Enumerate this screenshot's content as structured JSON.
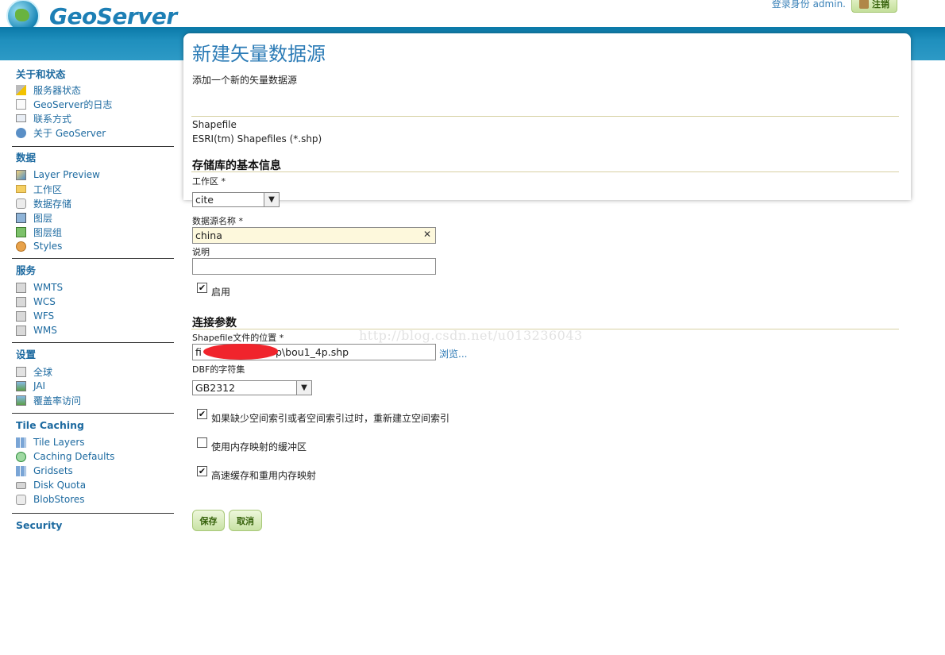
{
  "header": {
    "logo_text": "GeoServer",
    "login_text": "登录身份 admin.",
    "logout_label": "注销"
  },
  "sidebar": {
    "sections": [
      {
        "title": "关于和状态",
        "items": [
          "服务器状态",
          "GeoServer的日志",
          "联系方式",
          "关于 GeoServer"
        ]
      },
      {
        "title": "数据",
        "items": [
          "Layer Preview",
          "工作区",
          "数据存储",
          "图层",
          "图层组",
          "Styles"
        ]
      },
      {
        "title": "服务",
        "items": [
          "WMTS",
          "WCS",
          "WFS",
          "WMS"
        ]
      },
      {
        "title": "设置",
        "items": [
          "全球",
          "JAI",
          "覆盖率访问"
        ]
      },
      {
        "title": "Tile Caching",
        "items": [
          "Tile Layers",
          "Caching Defaults",
          "Gridsets",
          "Disk Quota",
          "BlobStores"
        ]
      },
      {
        "title": "Security",
        "items": []
      }
    ]
  },
  "main": {
    "title": "新建矢量数据源",
    "description": "添加一个新的矢量数据源",
    "store_type": "Shapefile",
    "store_type_desc": "ESRI(tm) Shapefiles (*.shp)",
    "basic_info_heading": "存储库的基本信息",
    "workspace_label": "工作区 *",
    "workspace_value": "cite",
    "name_label": "数据源名称 *",
    "name_value": "china",
    "desc_label": "说明",
    "desc_value": "",
    "enabled_label": "启用",
    "enabled": true,
    "conn_heading": "连接参数",
    "shp_label": "Shapefile文件的位置 *",
    "shp_value_prefix": "fi",
    "shp_value_suffix": "p\\bou1_4p.shp",
    "browse_label": "浏览...",
    "dbf_label": "DBF的字符集",
    "dbf_value": "GB2312",
    "options": [
      {
        "label": "如果缺少空间索引或者空间索引过时，重新建立空间索引",
        "checked": true
      },
      {
        "label": "使用内存映射的缓冲区",
        "checked": false
      },
      {
        "label": "高速缓存和重用内存映射",
        "checked": true
      }
    ],
    "save_label": "保存",
    "cancel_label": "取消"
  },
  "watermark": "http://blog.csdn.net/u013236043"
}
